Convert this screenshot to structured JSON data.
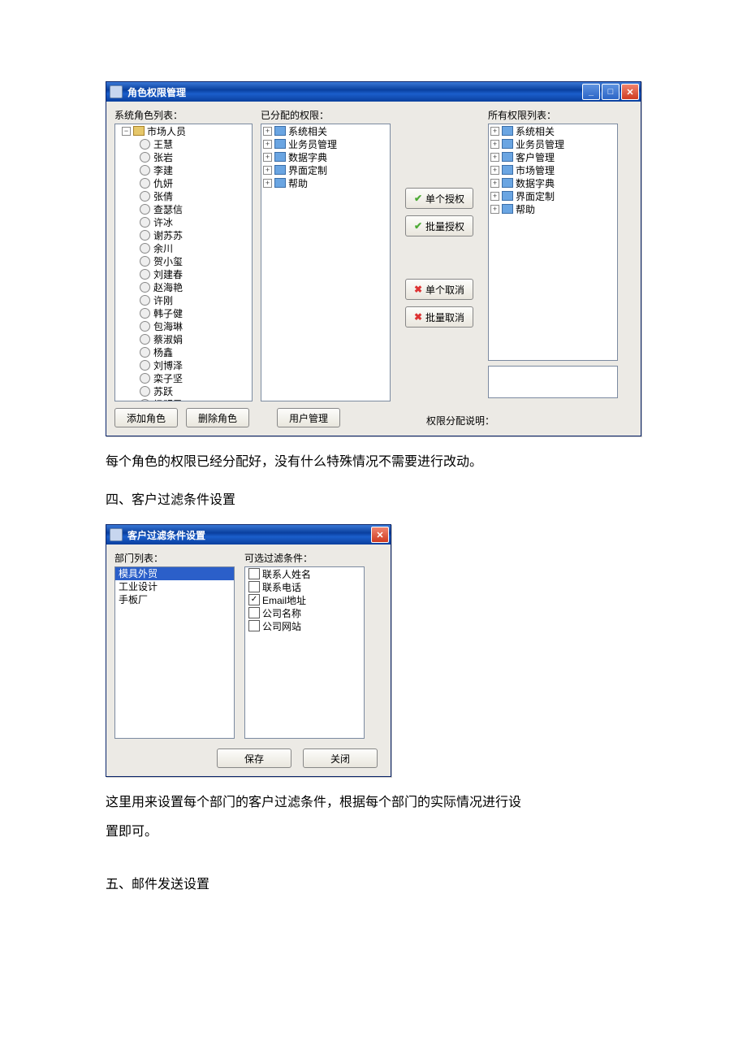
{
  "win1": {
    "title": "角色权限管理",
    "labels": {
      "roles": "系统角色列表：",
      "assigned": "已分配的权限：",
      "all": "所有权限列表：",
      "desc": "权限分配说明："
    },
    "role_root": "市场人员",
    "role_users": [
      "王慧",
      "张岩",
      "李建",
      "仇妍",
      "张倩",
      "查瑟信",
      "许冰",
      "谢苏苏",
      "余川",
      "贺小玺",
      "刘建春",
      "赵海艳",
      "许刚",
      "韩子健",
      "包海琳",
      "蔡淑娟",
      "杨鑫",
      "刘博泽",
      "栾子坚",
      "苏跃",
      "杨明勇"
    ],
    "assigned": [
      "系统相关",
      "业务员管理",
      "数据字典",
      "界面定制",
      "帮助"
    ],
    "all": [
      "系统相关",
      "业务员管理",
      "客户管理",
      "市场管理",
      "数据字典",
      "界面定制",
      "帮助"
    ],
    "mid_btns": {
      "grant_one": "单个授权",
      "grant_batch": "批量授权",
      "revoke_one": "单个取消",
      "revoke_batch": "批量取消"
    },
    "bottom_btns": {
      "add_role": "添加角色",
      "del_role": "删除角色",
      "user_mgmt": "用户管理"
    }
  },
  "doc": {
    "p1": "每个角色的权限已经分配好，没有什么特殊情况不需要进行改动。",
    "h4": "四、客户过滤条件设置",
    "p2a": "这里用来设置每个部门的客户过滤条件，根据每个部门的实际情况进行设",
    "p2b": "置即可。",
    "h5": "五、邮件发送设置"
  },
  "win2": {
    "title": "客户过滤条件设置",
    "labels": {
      "dept": "部门列表：",
      "filters": "可选过滤条件："
    },
    "depts": [
      "模具外贸",
      "工业设计",
      "手板厂"
    ],
    "filters": [
      {
        "label": "联系人姓名",
        "checked": false
      },
      {
        "label": "联系电话",
        "checked": false
      },
      {
        "label": "Email地址",
        "checked": true
      },
      {
        "label": "公司名称",
        "checked": false
      },
      {
        "label": "公司网站",
        "checked": false
      }
    ],
    "btns": {
      "save": "保存",
      "close": "关闭"
    }
  }
}
